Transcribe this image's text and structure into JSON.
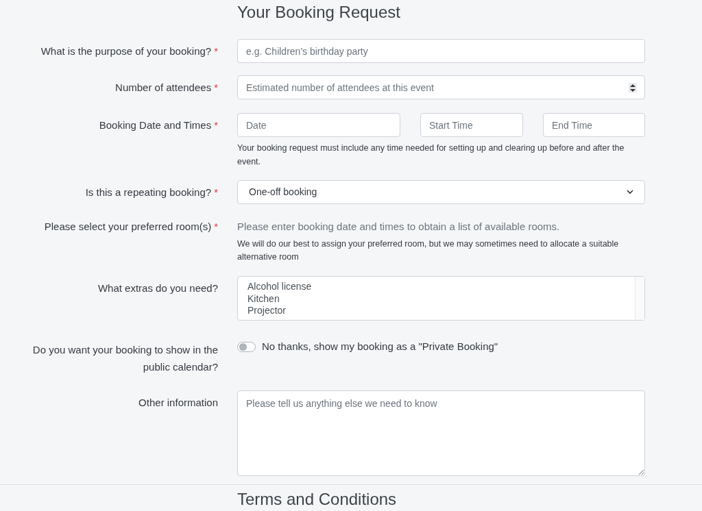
{
  "title": "Your Booking Request",
  "fields": [
    {
      "kind": "text",
      "label": "What is the purpose of your booking?",
      "required": true,
      "placeholder": "e.g. Children's birthday party"
    },
    {
      "kind": "number",
      "label": "Number of attendees",
      "required": true,
      "placeholder": "Estimated number of attendees at this event"
    },
    {
      "kind": "datetime",
      "label": "Booking Date and Times",
      "required": true,
      "inputs": [
        {
          "placeholder": "Date"
        },
        {
          "placeholder": "Start Time"
        },
        {
          "placeholder": "End Time"
        }
      ],
      "help": "Your booking request must include any time needed for setting up and clearing up before and after the event."
    },
    {
      "kind": "select",
      "label": "Is this a repeating booking?",
      "required": true,
      "value": "One-off booking"
    },
    {
      "kind": "rooms",
      "label": "Please select your preferred room(s)",
      "required": true,
      "message": "Please enter booking date and times to obtain a list of available rooms.",
      "help": "We will do our best to assign your preferred room, but we may sometimes need to allocate a suitable alternative room"
    },
    {
      "kind": "listbox",
      "label": "What extras do you need?",
      "required": false,
      "options": [
        {
          "label": "Alcohol license",
          "selected": false
        },
        {
          "label": "Kitchen",
          "selected": false
        },
        {
          "label": "Projector",
          "selected": false
        }
      ]
    },
    {
      "kind": "toggle",
      "label": "Do you want your booking to show in the public calendar?",
      "required": false,
      "on": false,
      "text": "No thanks, show my booking as a \"Private Booking\""
    },
    {
      "kind": "textarea",
      "label": "Other information",
      "required": false,
      "placeholder": "Please tell us anything else we need to know"
    }
  ],
  "required_mark": "*",
  "next_section": "Terms and Conditions"
}
